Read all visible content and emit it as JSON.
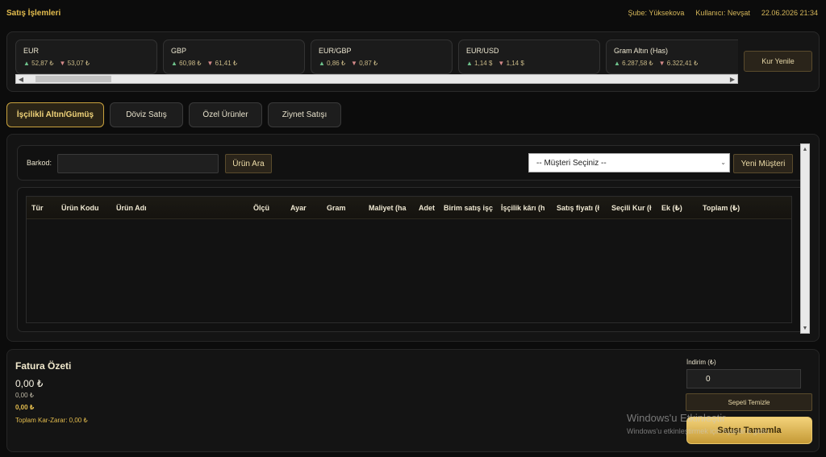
{
  "header": {
    "title": "Satış İşlemleri",
    "branch": "Şube: Yüksekova",
    "user": "Kullanıcı: Nevşat",
    "datetime": "22.06.2026 21:34"
  },
  "rates": [
    {
      "name": "EUR",
      "buy": "52,87 ₺",
      "sell": "53,07 ₺"
    },
    {
      "name": "GBP",
      "buy": "60,98 ₺",
      "sell": "61,41 ₺"
    },
    {
      "name": "EUR/GBP",
      "buy": "0,86 ₺",
      "sell": "0,87 ₺"
    },
    {
      "name": "EUR/USD",
      "buy": "1,14 $",
      "sell": "1,14 $"
    },
    {
      "name": "Gram Altın (Has)",
      "buy": "6.287,58 ₺",
      "sell": "6.322,41 ₺"
    }
  ],
  "rates_refresh_label": "Kur Yenile",
  "tabs": [
    {
      "label": "İşçilikli Altın/Gümüş",
      "active": true
    },
    {
      "label": "Döviz Satış",
      "active": false
    },
    {
      "label": "Özel Ürünler",
      "active": false
    },
    {
      "label": "Ziynet Satışı",
      "active": false
    }
  ],
  "search": {
    "barcode_label": "Barkod:",
    "barcode_value": "",
    "search_button": "Ürün Ara",
    "customer_select": "-- Müşteri Seçiniz --",
    "new_customer_button": "Yeni Müşteri"
  },
  "table": {
    "columns": [
      "Tür",
      "Ürün Kodu",
      "Ürün Adı",
      "Ölçü",
      "Ayar",
      "Gram",
      "Maliyet (ha",
      "Adet",
      "Birim satış işç",
      "İşçilik kârı (h",
      "Satış fiyatı (ł",
      "Seçili Kur (ł",
      "Ek (₺)",
      "Toplam (₺)"
    ],
    "rows": []
  },
  "summary": {
    "title": "Fatura Özeti",
    "total": "0,00 ₺",
    "sub": "0,00 ₺",
    "gold": "0,00 ₺",
    "profit": "Toplam Kar-Zarar: 0,00 ₺",
    "discount_label": "İndirim (₺)",
    "discount_value": "0",
    "clear_button": "Sepeti Temizle",
    "complete_button": "Satışı Tamamla"
  },
  "watermark": {
    "line1": "Windows'u Etkinleştir",
    "line2": "Windows'u etkinleştirmek için Ayarlar'a gidin."
  },
  "colors": {
    "accent_gold": "#e4bd4e",
    "up": "#6ec28c",
    "down": "#d58a8a"
  }
}
